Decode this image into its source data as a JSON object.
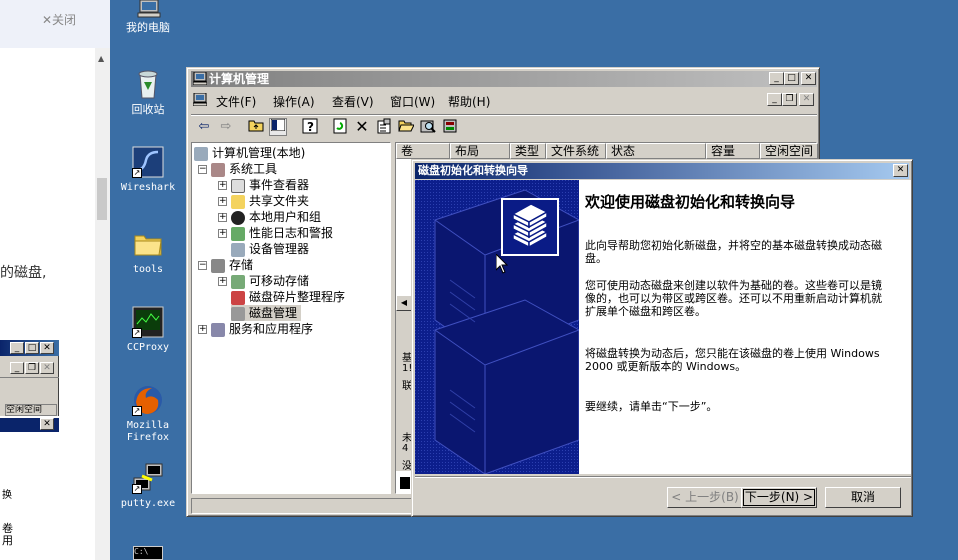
{
  "browser_panel": {
    "close_label": "✕关闭",
    "partial_text": "的磁盘,"
  },
  "small_window": {
    "col_header": "空闲空间",
    "text_1": "换",
    "text_2": "卷",
    "text_3": "用"
  },
  "desktop_icons": [
    {
      "label": "我的电脑",
      "icon": "my-computer-icon"
    },
    {
      "label": "回收站",
      "icon": "recycle-bin-icon"
    },
    {
      "label": "Wireshark",
      "icon": "wireshark-icon"
    },
    {
      "label": "tools",
      "icon": "folder-icon"
    },
    {
      "label": "CCProxy",
      "icon": "ccproxy-icon"
    },
    {
      "label": "Mozilla Firefox",
      "icon": "firefox-icon"
    },
    {
      "label": "putty.exe",
      "icon": "putty-icon"
    }
  ],
  "cm_window": {
    "title": "计算机管理",
    "menu": [
      "文件(F)",
      "操作(A)",
      "查看(V)",
      "窗口(W)",
      "帮助(H)"
    ],
    "tree": [
      {
        "label": "计算机管理(本地)",
        "level": 0,
        "expander": ""
      },
      {
        "label": "系统工具",
        "level": 1,
        "expander": "−"
      },
      {
        "label": "事件查看器",
        "level": 2,
        "expander": "+"
      },
      {
        "label": "共享文件夹",
        "level": 2,
        "expander": "+"
      },
      {
        "label": "本地用户和组",
        "level": 2,
        "expander": "+"
      },
      {
        "label": "性能日志和警报",
        "level": 2,
        "expander": "+"
      },
      {
        "label": "设备管理器",
        "level": 2,
        "expander": ""
      },
      {
        "label": "存储",
        "level": 1,
        "expander": "−"
      },
      {
        "label": "可移动存储",
        "level": 2,
        "expander": "+"
      },
      {
        "label": "磁盘碎片整理程序",
        "level": 2,
        "expander": ""
      },
      {
        "label": "磁盘管理",
        "level": 2,
        "expander": ""
      },
      {
        "label": "服务和应用程序",
        "level": 1,
        "expander": "+"
      }
    ],
    "columns": [
      "卷",
      "布局",
      "类型",
      "文件系统",
      "状态",
      "容量",
      "空闲空间"
    ],
    "right_fragments": [
      "基",
      "1!",
      "联",
      "未",
      "4",
      "没"
    ]
  },
  "wizard": {
    "title": "磁盘初始化和转换向导",
    "heading": "欢迎使用磁盘初始化和转换向导",
    "para1": "此向导帮助您初始化新磁盘，并将空的基本磁盘转换成动态磁盘。",
    "para2": "您可使用动态磁盘来创建以软件为基础的卷。这些卷可以是镜像的，也可以为带区或跨区卷。还可以不用重新启动计算机就扩展单个磁盘和跨区卷。",
    "para3": "将磁盘转换为动态后，您只能在该磁盘的卷上使用 Windows 2000 或更新版本的 Windows。",
    "para4": "要继续，请单击“下一步”。",
    "back_button": "< 上一步(B)",
    "next_button": "下一步(N) >",
    "cancel_button": "取消"
  }
}
